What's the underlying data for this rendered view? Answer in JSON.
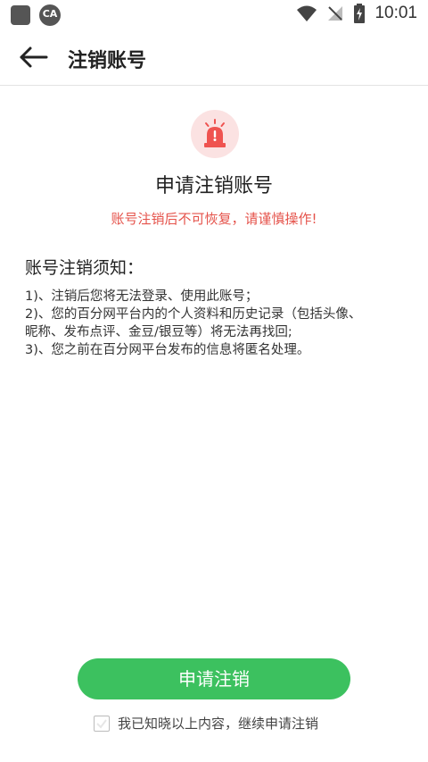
{
  "status_bar": {
    "time": "10:01",
    "app_icon_1": "square-icon",
    "app_icon_2": "cast-icon",
    "app_icon_2_text": "CA",
    "wifi": "wifi-icon",
    "signal": "no-signal-icon",
    "battery": "battery-charging-icon"
  },
  "appbar": {
    "title": "注销账号",
    "back_icon": "arrow-left-icon"
  },
  "content": {
    "alert_icon": "siren-icon",
    "title": "申请注销账号",
    "warning": "账号注销后不可恢复，请谨慎操作!",
    "notice_heading": "账号注销须知：",
    "notice_lines": [
      "1)、注销后您将无法登录、使用此账号；",
      "2)、您的百分网平台内的个人资料和历史记录（包括头像、",
      "昵称、发布点评、金豆/银豆等）将无法再找回;",
      "3)、您之前在百分网平台发布的信息将匿名处理。"
    ]
  },
  "footer": {
    "submit_label": "申请注销",
    "agree_text": "我已知晓以上内容，继续申请注销",
    "checkbox_checked": false
  },
  "colors": {
    "accent_green": "#3cc15f",
    "warning_red": "#e5534b",
    "badge_bg": "#fbe2e2"
  }
}
